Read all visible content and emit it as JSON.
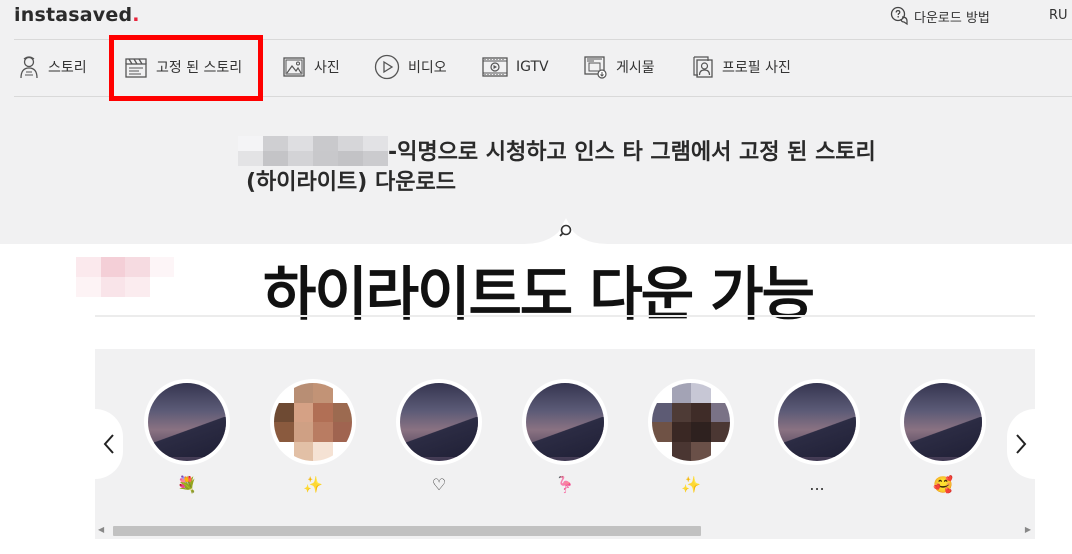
{
  "header": {
    "logo_text": "instasaved",
    "logo_dot": ".",
    "how_to_label": "다운로드 방법",
    "language": "RU"
  },
  "nav": {
    "items": [
      {
        "label": "스토리",
        "icon": "story-icon"
      },
      {
        "label": "고정 된 스토리",
        "icon": "clapperboard-icon"
      },
      {
        "label": "사진",
        "icon": "photo-icon"
      },
      {
        "label": "비디오",
        "icon": "play-icon"
      },
      {
        "label": "IGTV",
        "icon": "tv-icon"
      },
      {
        "label": "게시물",
        "icon": "post-icon"
      },
      {
        "label": "프로필 사진",
        "icon": "profile-photo-icon"
      }
    ]
  },
  "main": {
    "headline": "-익명으로 시청하고 인스 타 그램에서 고정 된 스토리 (하이라이트) 다운로드",
    "overlay_title": "하이라이트도 다운 가능"
  },
  "highlights": [
    {
      "label": "💐"
    },
    {
      "label": "✨"
    },
    {
      "label": "♡"
    },
    {
      "label": "🦩"
    },
    {
      "label": "✨"
    },
    {
      "label": "..."
    },
    {
      "label": "🥰"
    }
  ],
  "colors": {
    "logo_accent": "#e8243c",
    "highlight_box": "#ff0000",
    "page_background": "#f1f1f2"
  }
}
